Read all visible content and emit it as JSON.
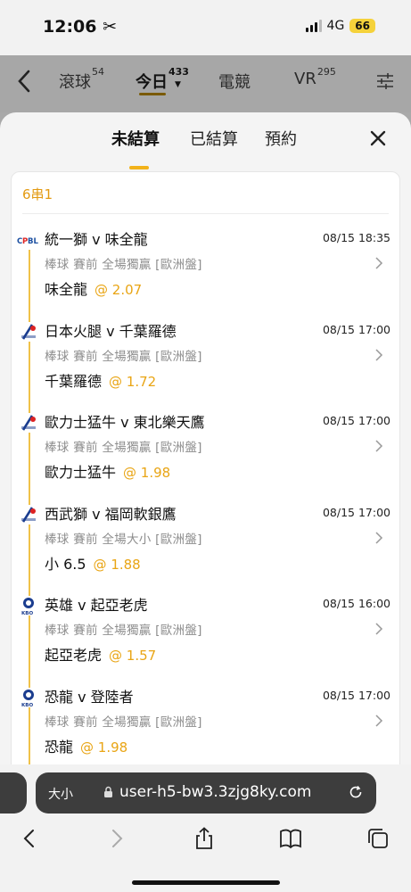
{
  "status": {
    "time": "12:06",
    "network": "4G",
    "battery": "66"
  },
  "nav": {
    "tabs": [
      {
        "label": "滾球",
        "count": "54"
      },
      {
        "label": "今日",
        "count": "433"
      },
      {
        "label": "電競",
        "count": ""
      },
      {
        "label": "VR",
        "count": "295"
      }
    ]
  },
  "sheet": {
    "tabs": [
      "未結算",
      "已結算",
      "預約"
    ],
    "parlay_title": "6串1",
    "bets": [
      {
        "league": "CPBL",
        "match": "統一獅 v 味全龍",
        "time": "08/15 18:35",
        "market": "棒球 賽前 全場獨贏 [歐洲盤]",
        "selection": "味全龍",
        "odds": "@ 2.07"
      },
      {
        "league": "NPB",
        "match": "日本火腿 v 千葉羅德",
        "time": "08/15 17:00",
        "market": "棒球 賽前 全場獨贏 [歐洲盤]",
        "selection": "千葉羅德",
        "odds": "@ 1.72"
      },
      {
        "league": "NPB",
        "match": "歐力士猛牛 v 東北樂天鷹",
        "time": "08/15 17:00",
        "market": "棒球 賽前 全場獨贏 [歐洲盤]",
        "selection": "歐力士猛牛",
        "odds": "@ 1.98"
      },
      {
        "league": "NPB",
        "match": "西武獅 v 福岡軟銀鷹",
        "time": "08/15 17:00",
        "market": "棒球 賽前 全場大小 [歐洲盤]",
        "selection": "小 6.5",
        "odds": "@ 1.88"
      },
      {
        "league": "KBO",
        "match": "英雄 v 起亞老虎",
        "time": "08/15 16:00",
        "market": "棒球 賽前 全場獨贏 [歐洲盤]",
        "selection": "起亞老虎",
        "odds": "@ 1.57"
      },
      {
        "league": "KBO",
        "match": "恐龍 v 登陸者",
        "time": "08/15 17:00",
        "market": "棒球 賽前 全場獨贏 [歐洲盤]",
        "selection": "恐龍",
        "odds": "@ 1.98"
      }
    ]
  },
  "browser": {
    "text_size": "大小",
    "url": "user-h5-bw3.3zjg8ky.com"
  },
  "colors": {
    "accent": "#f2b21a",
    "odds": "#e9a515",
    "parlay_title": "#e39a12"
  }
}
